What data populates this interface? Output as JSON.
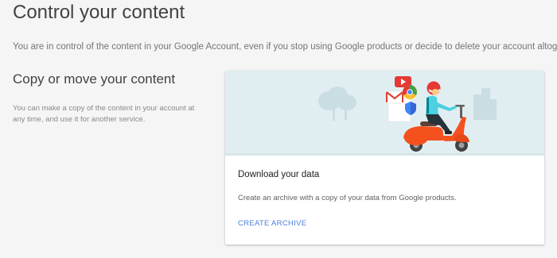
{
  "page": {
    "title": "Control your content",
    "intro": "You are in control of the content in your Google Account, even if you stop using Google products or decide to delete your account altogether."
  },
  "section": {
    "title": "Copy or move your content",
    "description": "You can make a copy of the content in your account at any time, and use it for another service."
  },
  "card": {
    "illustration": "scooter-rider-delivering-google-products-illustration",
    "title": "Download your data",
    "description": "Create an archive with a copy of your data from Google products.",
    "action_label": "CREATE ARCHIVE"
  },
  "colors": {
    "background": "#f5f5f5",
    "card_background": "#ffffff",
    "illustration_background": "#e1eef1",
    "accent_link": "#4a7fd8",
    "scooter": "#f4511e",
    "rider_jacket": "#4dd0e1"
  }
}
